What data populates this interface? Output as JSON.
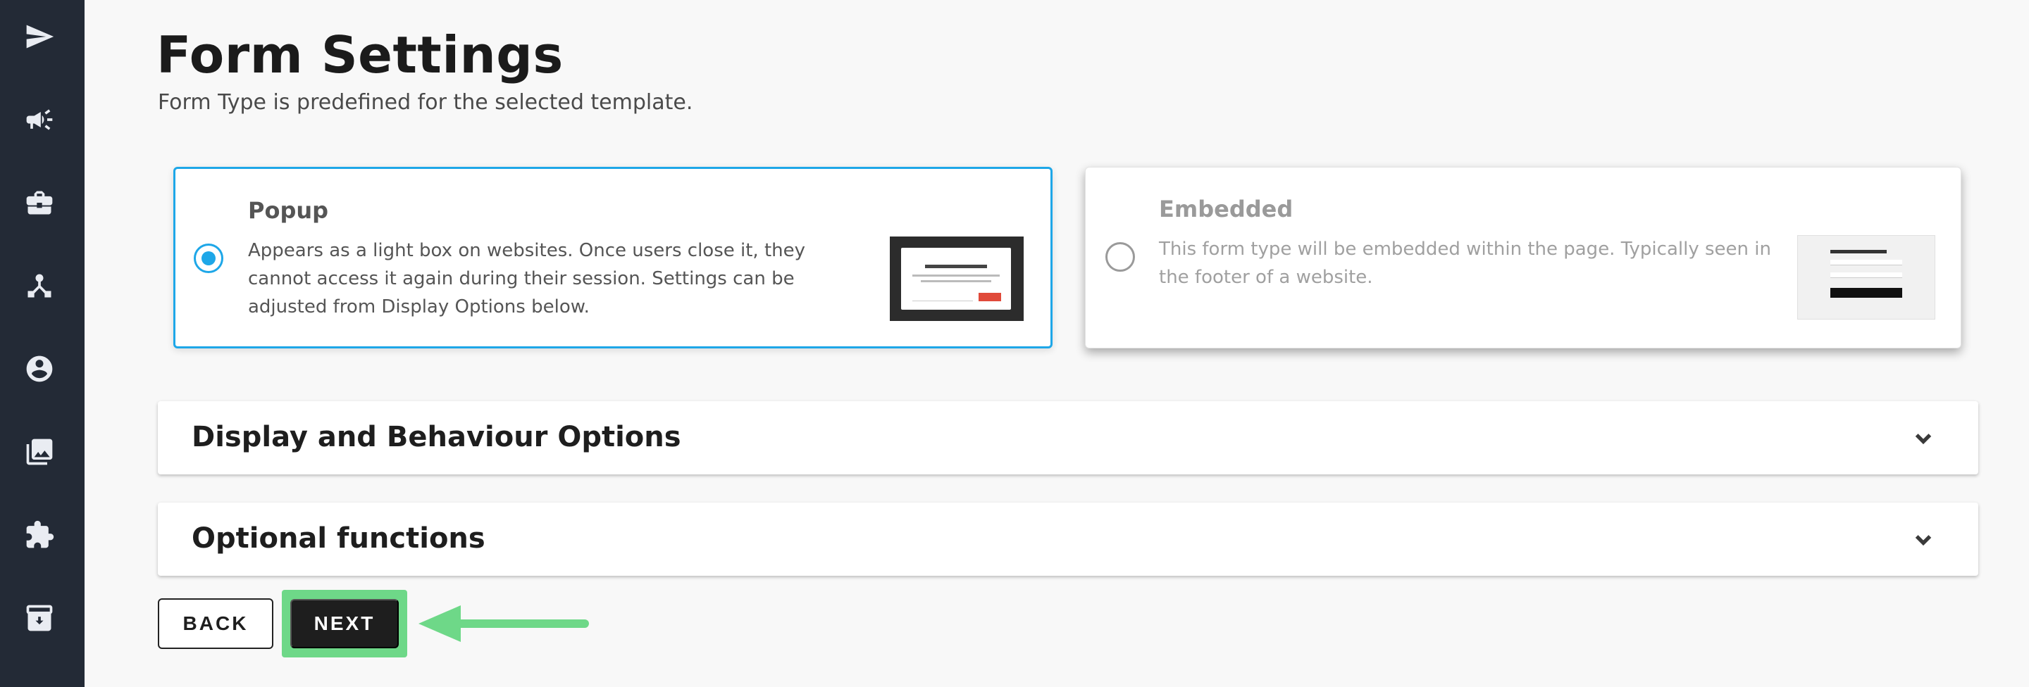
{
  "sidebar": {
    "items": [
      {
        "icon": "send-icon"
      },
      {
        "icon": "megaphone-icon"
      },
      {
        "icon": "briefcase-icon"
      },
      {
        "icon": "network-icon"
      },
      {
        "icon": "account-circle-icon"
      },
      {
        "icon": "photo-library-icon"
      },
      {
        "icon": "puzzle-icon"
      },
      {
        "icon": "archive-icon"
      }
    ]
  },
  "header": {
    "title": "Form Settings",
    "subtitle": "Form Type is predefined for the selected template."
  },
  "form_types": [
    {
      "title": "Popup",
      "description": "Appears as a light box on websites. Once users close it, they cannot access it again during their session. Settings can be adjusted from Display Options below.",
      "selected": true
    },
    {
      "title": "Embedded",
      "description": "This form type will be embedded within the page. Typically seen in the footer of a website.",
      "selected": false
    }
  ],
  "accordions": [
    {
      "title": "Display and Behaviour Options"
    },
    {
      "title": "Optional functions"
    }
  ],
  "actions": {
    "back_label": "BACK",
    "next_label": "NEXT"
  },
  "colors": {
    "accent": "#1ea7e8",
    "sidebar": "#232a36",
    "highlight": "#6ed888"
  }
}
